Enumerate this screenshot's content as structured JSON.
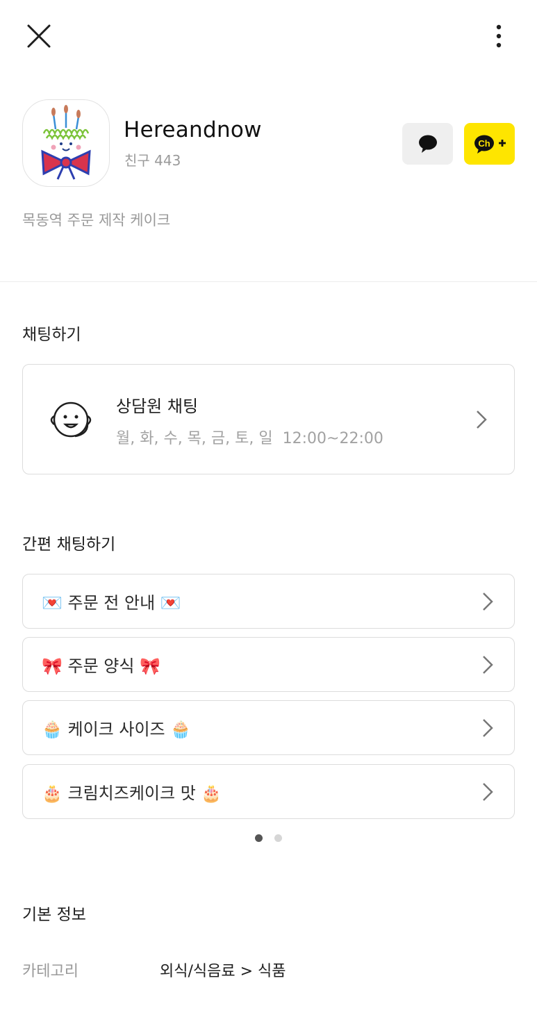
{
  "profile": {
    "channel_name": "Hereandnow",
    "friend_label": "친구",
    "friend_count": "443",
    "description": "목동역 주문 제작 케이크"
  },
  "sections": {
    "chat_title": "채팅하기",
    "quick_chat_title": "간편 채팅하기",
    "basic_info_title": "기본 정보"
  },
  "agent_chat": {
    "title": "상담원 채팅",
    "days": "월, 화, 수, 목, 금, 토, 일",
    "hours": "12:00~22:00"
  },
  "quick_items": [
    {
      "label": "💌 주문 전 안내 💌"
    },
    {
      "label": "🎀 주문 양식 🎀"
    },
    {
      "label": "🧁 케이크 사이즈 🧁"
    },
    {
      "label": "🎂 크림치즈케이크 맛 🎂"
    }
  ],
  "pager": {
    "current": 1,
    "total": 2
  },
  "basic_info": {
    "category_key": "카테고리",
    "category_value": "외식/식음료 > 식품"
  },
  "colors": {
    "brand_yellow": "#fee500",
    "chat_button_bg": "#efefef",
    "muted_text": "#9a9a9a",
    "border": "#dcdcdc",
    "dot_active": "#555555",
    "dot_inactive": "#d6d6d6"
  },
  "icons": {
    "close": "close-icon",
    "more": "more-vertical-icon",
    "chat": "chat-bubble-icon",
    "add_channel": "channel-add-icon",
    "agent": "agent-face-icon",
    "chevron": "chevron-right-icon"
  }
}
